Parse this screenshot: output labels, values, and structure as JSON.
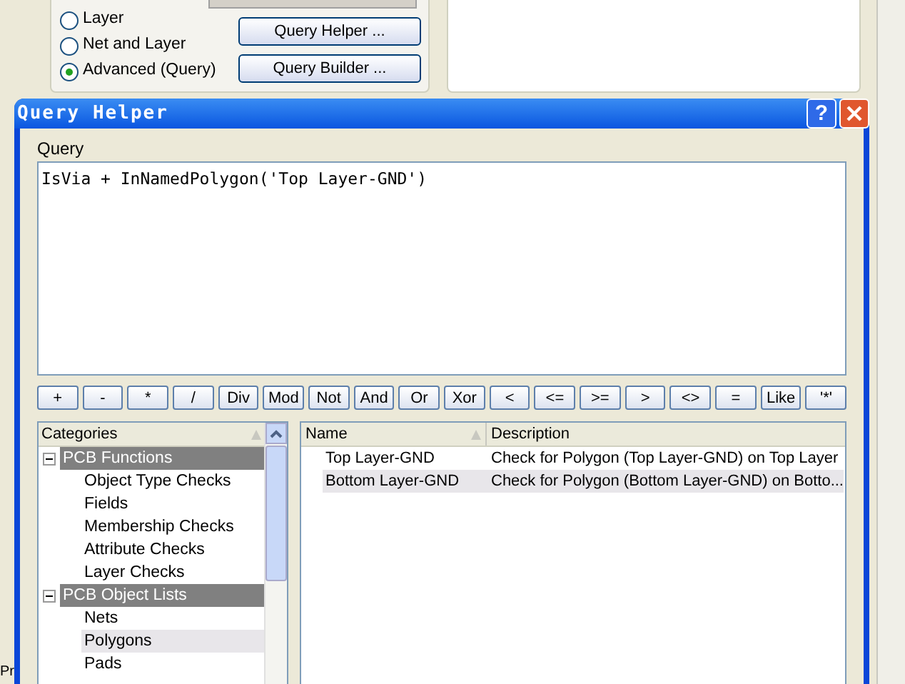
{
  "background_window": {
    "filter_options": [
      {
        "label": "Layer",
        "selected": false
      },
      {
        "label": "Net and Layer",
        "selected": false
      },
      {
        "label": "Advanced (Query)",
        "selected": true
      }
    ],
    "buttons": [
      "Query Helper ...",
      "Query Builder ..."
    ],
    "cut_label": "Pr"
  },
  "dialog": {
    "title": "Query Helper",
    "help_button": "?",
    "query_label": "Query",
    "query": "IsVia + InNamedPolygon('Top Layer-GND')",
    "operators": [
      "+",
      "-",
      "*",
      "/",
      "Div",
      "Mod",
      "Not",
      "And",
      "Or",
      "Xor",
      "<",
      "<=",
      ">=",
      ">",
      "<>",
      "=",
      "Like",
      "'*'"
    ],
    "categories": {
      "header": "Categories",
      "groups": [
        {
          "label": "PCB Functions",
          "expanded": true,
          "children": [
            {
              "label": "Object Type Checks",
              "selected": false
            },
            {
              "label": "Fields",
              "selected": false
            },
            {
              "label": "Membership Checks",
              "selected": false
            },
            {
              "label": "Attribute Checks",
              "selected": false
            },
            {
              "label": "Layer Checks",
              "selected": false
            }
          ]
        },
        {
          "label": "PCB Object Lists",
          "expanded": true,
          "children": [
            {
              "label": "Nets",
              "selected": false
            },
            {
              "label": "Polygons",
              "selected": true
            },
            {
              "label": "Pads",
              "selected": false
            }
          ]
        }
      ]
    },
    "table": {
      "columns": [
        "Name",
        "Description"
      ],
      "rows": [
        {
          "name": "Top Layer-GND",
          "description": "Check for Polygon  (Top Layer-GND)  on Top Layer",
          "selected": false
        },
        {
          "name": "Bottom Layer-GND",
          "description": "Check for Polygon  (Bottom Layer-GND)  on Botto...",
          "selected": true
        }
      ]
    }
  }
}
